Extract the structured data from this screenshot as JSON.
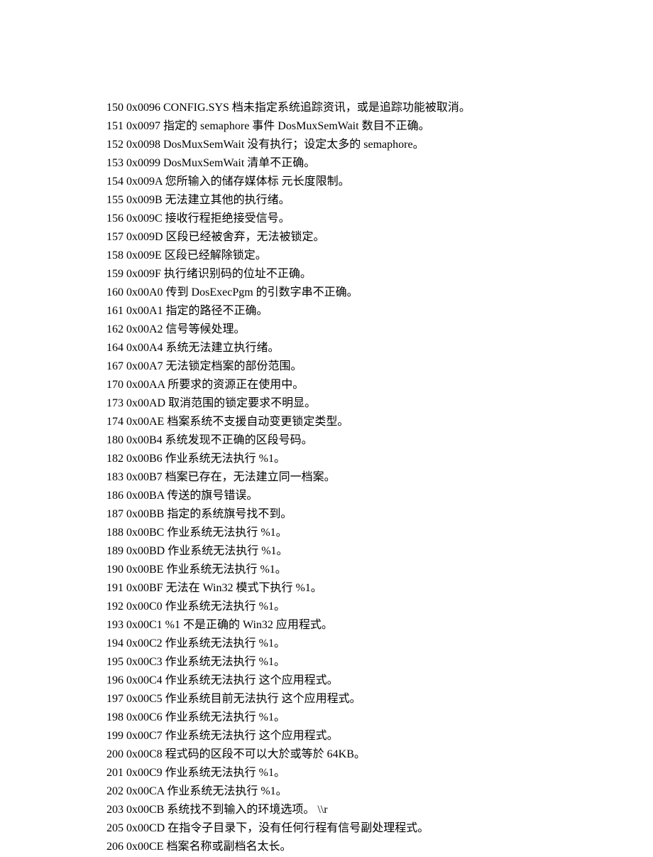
{
  "lines": [
    "150 0x0096 CONFIG.SYS 档未指定系统追踪资讯，或是追踪功能被取消。",
    "151 0x0097 指定的 semaphore 事件 DosMuxSemWait 数目不正确。",
    "152 0x0098 DosMuxSemWait 没有执行；设定太多的 semaphore。",
    "153 0x0099 DosMuxSemWait 清单不正确。",
    "154 0x009A 您所输入的储存媒体标 元长度限制。",
    "155 0x009B 无法建立其他的执行绪。",
    "156 0x009C 接收行程拒绝接受信号。",
    "157 0x009D 区段已经被舍弃，无法被锁定。",
    "158 0x009E 区段已经解除锁定。",
    "159 0x009F 执行绪识别码的位址不正确。",
    "160 0x00A0 传到 DosExecPgm 的引数字串不正确。",
    "161 0x00A1 指定的路径不正确。",
    "162 0x00A2 信号等候处理。",
    "164 0x00A4 系统无法建立执行绪。",
    "167 0x00A7 无法锁定档案的部份范围。",
    "170 0x00AA 所要求的资源正在使用中。",
    "173 0x00AD 取消范围的锁定要求不明显。",
    "174 0x00AE 档案系统不支援自动变更锁定类型。",
    "180 0x00B4 系统发现不正确的区段号码。",
    "182 0x00B6 作业系统无法执行 %1。",
    "183 0x00B7 档案已存在，无法建立同一档案。",
    "186 0x00BA 传送的旗号错误。",
    "187 0x00BB 指定的系统旗号找不到。",
    "188 0x00BC 作业系统无法执行 %1。",
    "189 0x00BD 作业系统无法执行 %1。",
    "190 0x00BE 作业系统无法执行 %1。",
    "191 0x00BF 无法在 Win32 模式下执行 %1。",
    "192 0x00C0 作业系统无法执行 %1。",
    "193 0x00C1 %1 不是正确的 Win32 应用程式。",
    "194 0x00C2 作业系统无法执行 %1。",
    "195 0x00C3 作业系统无法执行 %1。",
    "196 0x00C4 作业系统无法执行 这个应用程式。",
    "197 0x00C5 作业系统目前无法执行 这个应用程式。",
    "198 0x00C6 作业系统无法执行 %1。",
    "199 0x00C7 作业系统无法执行 这个应用程式。",
    "200 0x00C8 程式码的区段不可以大於或等於 64KB。",
    "201 0x00C9 作业系统无法执行 %1。",
    "202 0x00CA 作业系统无法执行 %1。",
    "203 0x00CB 系统找不到输入的环境选项。 \\\\r",
    "205 0x00CD 在指令子目录下，没有任何行程有信号副处理程式。",
    "206 0x00CE 档案名称或副档名太长。"
  ]
}
